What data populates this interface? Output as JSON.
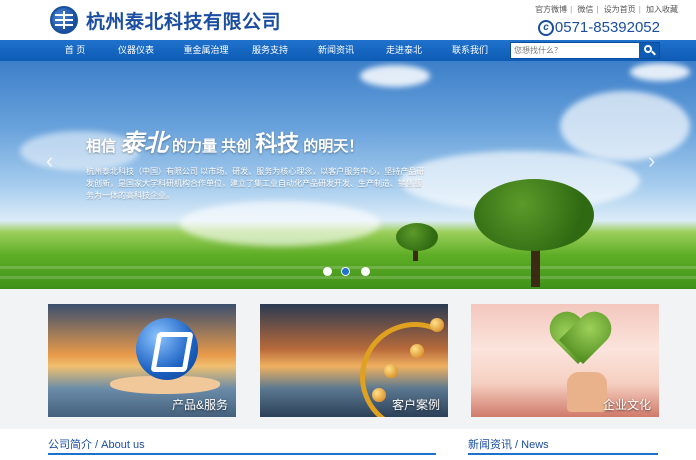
{
  "header": {
    "company_name": "杭州泰北科技有限公司",
    "top_links": [
      "官方微博",
      "微信",
      "设为首页",
      "加入收藏"
    ],
    "phone": "0571-85392052"
  },
  "nav": {
    "items": [
      "首 页",
      "仪器仪表",
      "重金属治理",
      "服务支持",
      "新闻资讯",
      "走进泰北",
      "联系我们"
    ],
    "search_placeholder": "您想找什么？"
  },
  "banner": {
    "slogan_prefix": "相信",
    "slogan_brand": "泰北",
    "slogan_mid": "的力量  共创",
    "slogan_tech": "科技",
    "slogan_end": "的明天！",
    "description": "杭州泰北科技（中国）有限公司 以市场、研发、服务为核心理念，以客户服务中心，坚持产品研发创新，是国家大学科研机构合作单位，建立了集工业自动化产品研发开发、生产制造、销售服务为一体的高科技企业。",
    "slides": 3,
    "active_slide": 2
  },
  "cards": [
    {
      "label": "产品&服务"
    },
    {
      "label": "客户案例"
    },
    {
      "label": "企业文化"
    }
  ],
  "sections": {
    "about": "公司简介 / About us",
    "news": "新闻资讯 / News"
  }
}
